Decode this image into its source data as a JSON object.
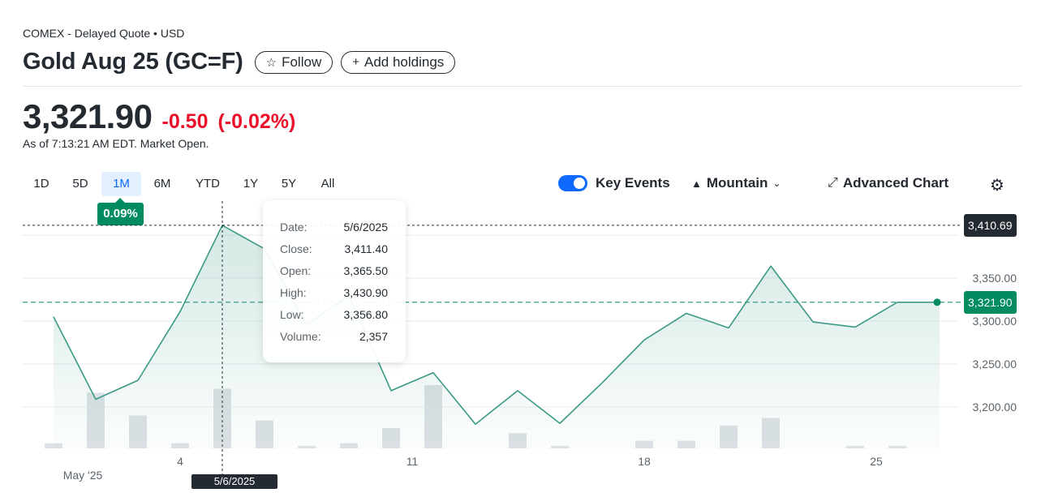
{
  "header": {
    "exchange": "COMEX - Delayed Quote • USD",
    "title": "Gold Aug 25 (GC=F)",
    "follow_label": "Follow",
    "add_holdings_label": "Add holdings"
  },
  "quote": {
    "price": "3,321.90",
    "change": "-0.50",
    "change_pct": "(-0.02%)",
    "as_of": "As of 7:13:21 AM EDT. Market Open."
  },
  "ranges": [
    "1D",
    "5D",
    "1M",
    "6M",
    "YTD",
    "1Y",
    "5Y",
    "All"
  ],
  "active_range": "1M",
  "range_performance": "0.09%",
  "toolbar": {
    "key_events_label": "Key Events",
    "chart_type_label": "Mountain",
    "advanced_chart_label": "Advanced Chart"
  },
  "tooltip": {
    "rows": [
      {
        "label": "Date:",
        "value": "5/6/2025"
      },
      {
        "label": "Close:",
        "value": "3,411.40"
      },
      {
        "label": "Open:",
        "value": "3,365.50"
      },
      {
        "label": "High:",
        "value": "3,430.90"
      },
      {
        "label": "Low:",
        "value": "3,356.80"
      },
      {
        "label": "Volume:",
        "value": "2,357"
      }
    ]
  },
  "tags": {
    "crosshair_price": "3,410.69",
    "current_price": "3,321.90",
    "crosshair_date": "5/6/2025"
  },
  "colors": {
    "line": "#3a9a85",
    "positive": "#008b60",
    "negative": "#eb0f29",
    "active_range": "#0f69ff"
  },
  "chart_data": {
    "type": "area",
    "x": [
      "4/30/2025",
      "5/1/2025",
      "5/2/2025",
      "5/5/2025",
      "5/6/2025",
      "5/7/2025",
      "5/8/2025",
      "5/9/2025",
      "5/12/2025",
      "5/13/2025",
      "5/14/2025",
      "5/15/2025",
      "5/16/2025",
      "5/19/2025",
      "5/20/2025",
      "5/21/2025",
      "5/22/2025",
      "5/23/2025",
      "5/26/2025",
      "5/27/2025",
      "5/28/2025",
      "5/29/2025"
    ],
    "close": [
      3305,
      3209,
      3231,
      3311,
      3411.4,
      3384,
      3296,
      3330,
      3219,
      3240,
      3180,
      3219,
      3181,
      3228,
      3278,
      3309,
      3292,
      3364,
      3299,
      3293,
      3321.9,
      3321.9
    ],
    "volume": [
      2,
      22,
      13,
      2,
      23.57,
      11,
      1,
      2,
      8,
      25,
      0,
      6,
      1,
      0,
      3,
      3,
      9,
      12,
      0,
      1,
      1,
      0
    ],
    "y_ticks": [
      "3,200.00",
      "3,250.00",
      "3,300.00",
      "3,350.00"
    ],
    "ylim": [
      3140,
      3425
    ],
    "x_tick_labels": [
      {
        "label": "May '25",
        "index": 0.5
      },
      {
        "label": "4",
        "index": 3
      },
      {
        "label": "11",
        "index": 8.5
      },
      {
        "label": "18",
        "index": 14
      },
      {
        "label": "25",
        "index": 19.5
      }
    ],
    "reference_price": 3321.9,
    "grid": true
  }
}
